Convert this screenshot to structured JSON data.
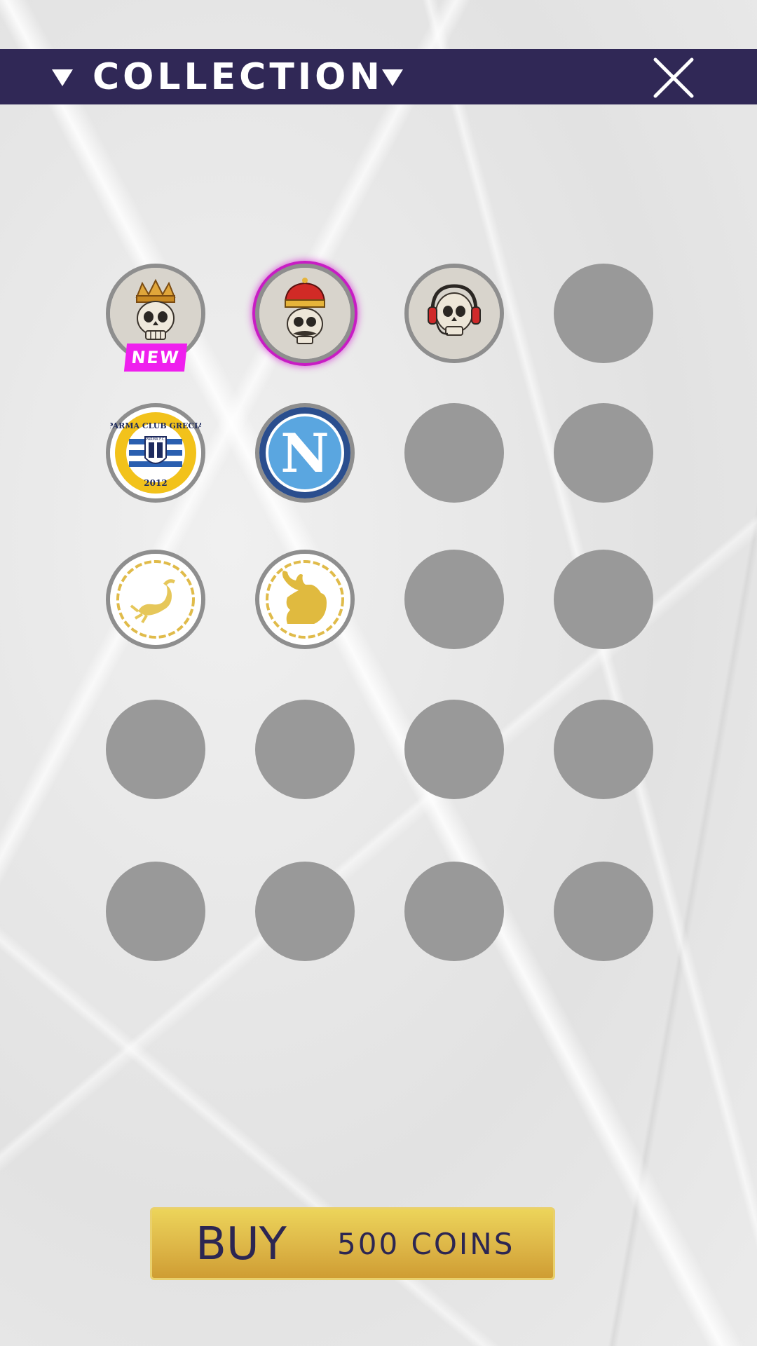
{
  "header": {
    "title": "COLLECTION",
    "background": "#302856"
  },
  "collection": {
    "items": [
      {
        "slot": 1,
        "state": "owned",
        "icon": "crowned-skull-gold-crown-icon",
        "badge": "NEW"
      },
      {
        "slot": 2,
        "state": "selected",
        "icon": "king-skull-red-crown-icon"
      },
      {
        "slot": 3,
        "state": "owned",
        "icon": "skull-headphones-icon"
      },
      {
        "slot": 4,
        "state": "locked"
      },
      {
        "slot": 5,
        "state": "owned",
        "icon": "parma-club-grecia-logo-icon",
        "logo_text": [
          "PARMA CLUB GRECIA",
          "2012",
          "PARMA F.C."
        ]
      },
      {
        "slot": 6,
        "state": "owned",
        "icon": "napoli-n-logo-icon",
        "logo_text": [
          "N"
        ]
      },
      {
        "slot": 7,
        "state": "locked"
      },
      {
        "slot": 8,
        "state": "locked"
      },
      {
        "slot": 9,
        "state": "owned",
        "icon": "gold-scorpion-icon"
      },
      {
        "slot": 10,
        "state": "owned",
        "icon": "gold-moose-icon"
      },
      {
        "slot": 11,
        "state": "locked"
      },
      {
        "slot": 12,
        "state": "locked"
      },
      {
        "slot": 13,
        "state": "locked"
      },
      {
        "slot": 14,
        "state": "locked"
      },
      {
        "slot": 15,
        "state": "locked"
      },
      {
        "slot": 16,
        "state": "locked"
      },
      {
        "slot": 17,
        "state": "locked"
      },
      {
        "slot": 18,
        "state": "locked"
      },
      {
        "slot": 19,
        "state": "locked"
      },
      {
        "slot": 20,
        "state": "locked"
      }
    ],
    "new_badge": "NEW",
    "selected_color": "#c81cc4",
    "locked_color": "#999999"
  },
  "buy_button": {
    "label": "BUY",
    "price": "500 COINS",
    "color": "#ddb647"
  }
}
